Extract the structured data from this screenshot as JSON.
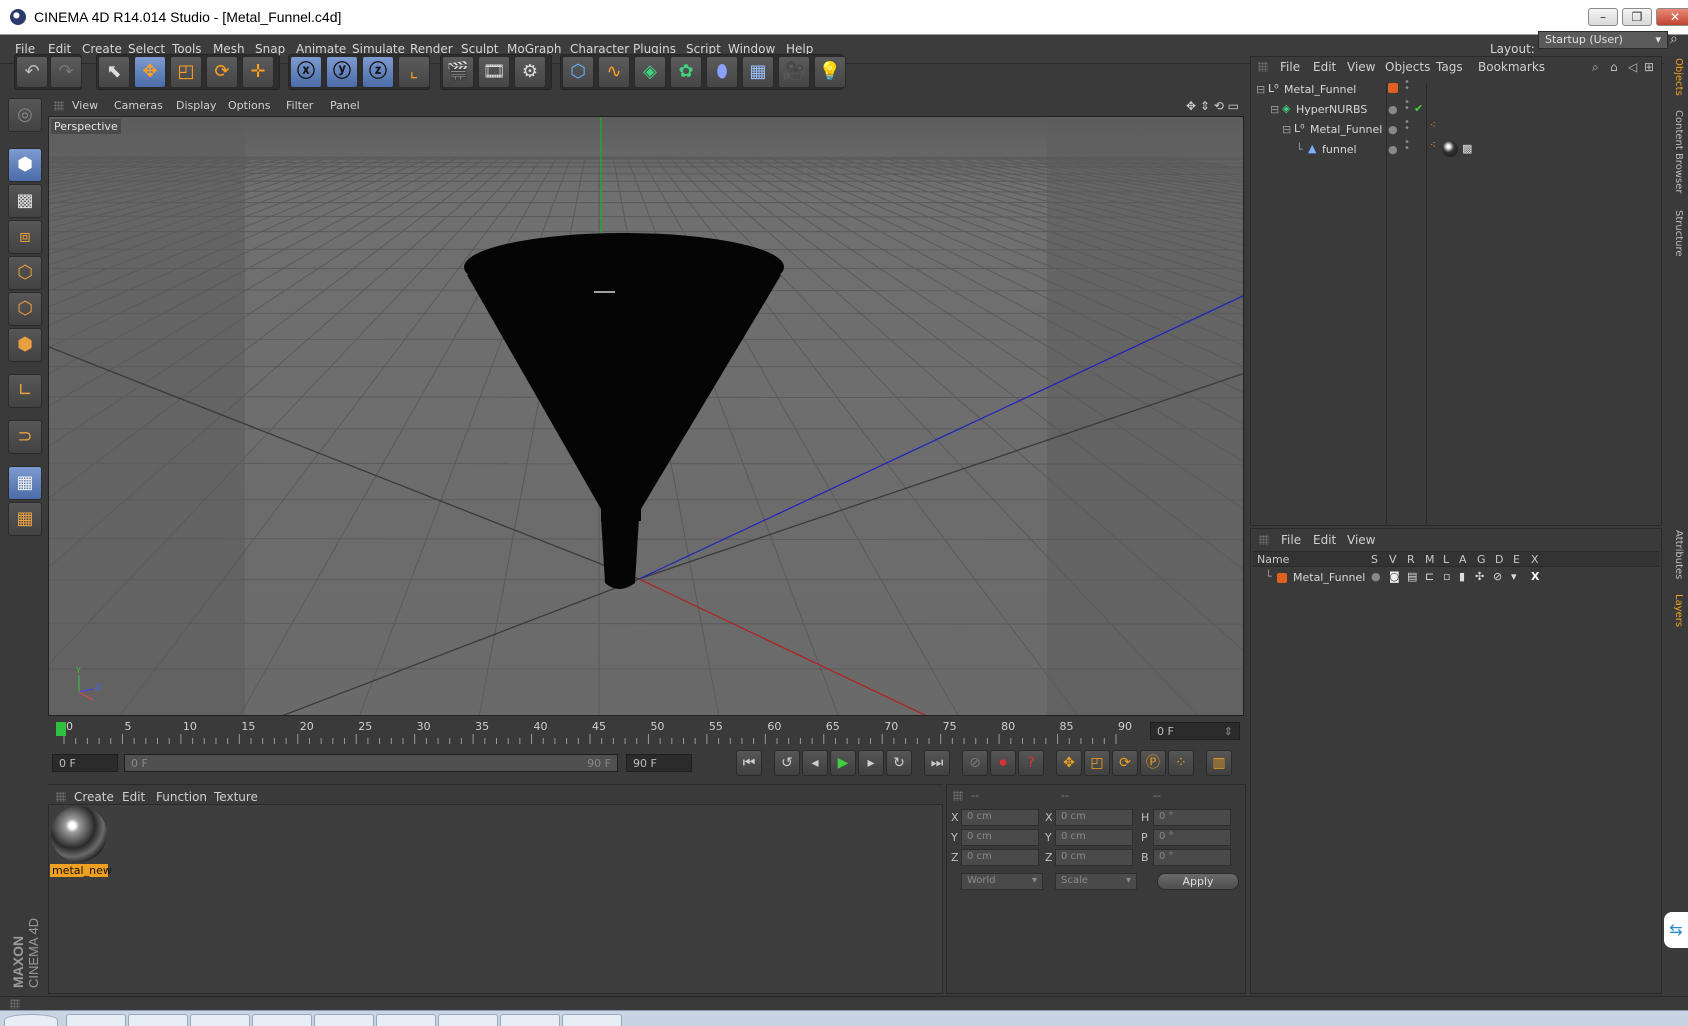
{
  "window": {
    "title": "CINEMA 4D R14.014 Studio - [Metal_Funnel.c4d]"
  },
  "menubar": [
    "File",
    "Edit",
    "Create",
    "Select",
    "Tools",
    "Mesh",
    "Snap",
    "Animate",
    "Simulate",
    "Render",
    "Sculpt",
    "MoGraph",
    "Character",
    "Plugins",
    "Script",
    "Window",
    "Help"
  ],
  "layout": {
    "label": "Layout:",
    "value": "Startup (User)"
  },
  "viewport": {
    "menu": [
      "View",
      "Cameras",
      "Display",
      "Options",
      "Filter",
      "Panel"
    ],
    "label": "Perspective"
  },
  "timeline": {
    "ticks": [
      "0",
      "5",
      "10",
      "15",
      "20",
      "25",
      "30",
      "35",
      "40",
      "45",
      "50",
      "55",
      "60",
      "65",
      "70",
      "75",
      "80",
      "85",
      "90"
    ],
    "current_frame": "0 F",
    "start_field": "0 F",
    "range_start": "0 F",
    "range_end": "90 F",
    "end_field": "90 F"
  },
  "material_manager": {
    "menu": [
      "Create",
      "Edit",
      "Function",
      "Texture"
    ],
    "materials": [
      {
        "name": "metal_new"
      }
    ]
  },
  "coordinates": {
    "headers": [
      "--",
      "--",
      "--"
    ],
    "rows": [
      {
        "l1": "X",
        "v1": "0 cm",
        "l2": "X",
        "v2": "0 cm",
        "l3": "H",
        "v3": "0 °"
      },
      {
        "l1": "Y",
        "v1": "0 cm",
        "l2": "Y",
        "v2": "0 cm",
        "l3": "P",
        "v3": "0 °"
      },
      {
        "l1": "Z",
        "v1": "0 cm",
        "l2": "Z",
        "v2": "0 cm",
        "l3": "B",
        "v3": "0 °"
      }
    ],
    "world": "World",
    "scale": "Scale",
    "apply": "Apply"
  },
  "object_manager": {
    "menu": [
      "File",
      "Edit",
      "View",
      "Objects",
      "Tags",
      "Bookmarks"
    ],
    "objects": [
      {
        "name": "Metal_Funnel"
      },
      {
        "name": "HyperNURBS"
      },
      {
        "name": "Metal_Funnel"
      },
      {
        "name": "funnel"
      }
    ]
  },
  "layer_manager": {
    "menu": [
      "File",
      "Edit",
      "View"
    ],
    "columns": [
      "Name",
      "S",
      "V",
      "R",
      "M",
      "L",
      "A",
      "G",
      "D",
      "E",
      "X"
    ],
    "layers": [
      {
        "name": "Metal_Funnel"
      }
    ]
  },
  "side_tabs": [
    "Objects",
    "Content Browser",
    "Structure",
    "Attributes",
    "Layers"
  ],
  "brand": {
    "maxon": "MAXON",
    "cinema": "CINEMA 4D"
  },
  "colors": {
    "accent": "#f0a020",
    "selected": "#5a7ab8",
    "bg": "#3a3a3a"
  }
}
